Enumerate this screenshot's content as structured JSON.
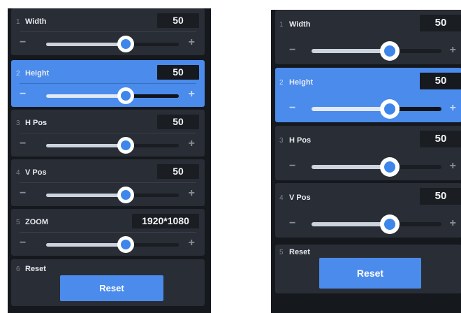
{
  "left_panel": {
    "rows": [
      {
        "num": "1",
        "label": "Width",
        "value": "50",
        "level": 0.6,
        "selected": false
      },
      {
        "num": "2",
        "label": "Height",
        "value": "50",
        "level": 0.6,
        "selected": true
      },
      {
        "num": "3",
        "label": "H Pos",
        "value": "50",
        "level": 0.6,
        "selected": false
      },
      {
        "num": "4",
        "label": "V Pos",
        "value": "50",
        "level": 0.6,
        "selected": false
      },
      {
        "num": "5",
        "label": "ZOOM",
        "value": "1920*1080",
        "level": 0.6,
        "selected": false
      }
    ],
    "reset": {
      "num": "6",
      "label": "Reset",
      "button_label": "Reset"
    }
  },
  "right_panel": {
    "rows": [
      {
        "num": "1",
        "label": "Width",
        "value": "50",
        "level": 0.6,
        "selected": false
      },
      {
        "num": "2",
        "label": "Height",
        "value": "50",
        "level": 0.6,
        "selected": true
      },
      {
        "num": "3",
        "label": "H Pos",
        "value": "50",
        "level": 0.6,
        "selected": false
      },
      {
        "num": "4",
        "label": "V Pos",
        "value": "50",
        "level": 0.6,
        "selected": false
      }
    ],
    "reset": {
      "num": "5",
      "label": "Reset",
      "button_label": "Reset"
    }
  },
  "controls": {
    "minus_symbol": "−",
    "plus_symbol": "+"
  },
  "colors": {
    "accent": "#4a8bec",
    "panel_bg": "#15181d",
    "card_bg": "#292d35",
    "knob": "#3e86ea"
  }
}
